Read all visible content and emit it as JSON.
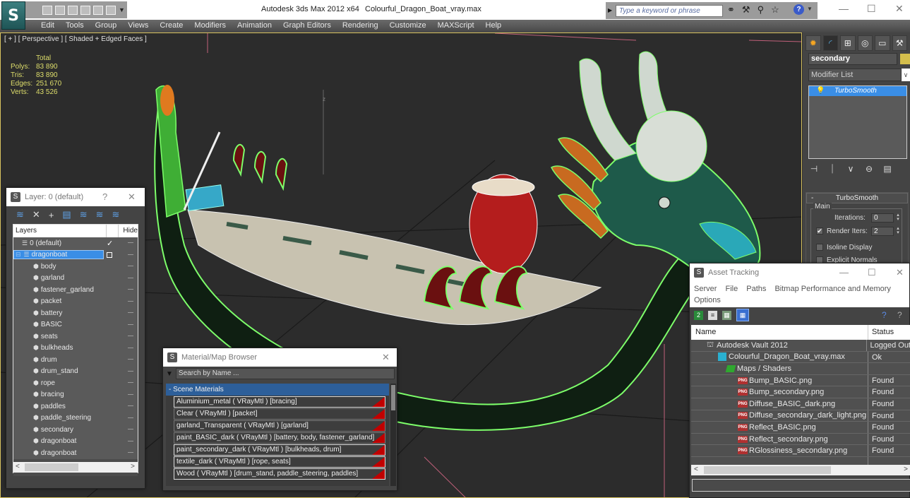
{
  "app": {
    "title": "Autodesk 3ds Max  2012 x64",
    "file": "Colourful_Dragon_Boat_vray.max",
    "logo": "3ds-max-logo",
    "search_placeholder": "Type a keyword or phrase",
    "infocenter_icons": [
      "binoculars-icon",
      "wrench-icon",
      "satellite-icon",
      "star-icon"
    ],
    "help": "?",
    "window_controls": {
      "minimize": "—",
      "maximize": "☐",
      "close": "✕"
    }
  },
  "menu": [
    "Edit",
    "Tools",
    "Group",
    "Views",
    "Create",
    "Modifiers",
    "Animation",
    "Graph Editors",
    "Rendering",
    "Customize",
    "MAXScript",
    "Help"
  ],
  "viewport": {
    "label": "[ + ] [ Perspective ] [ Shaded + Edged Faces ]",
    "stats": {
      "header": "Total",
      "rows": [
        {
          "key": "Polys:",
          "value": "83 890"
        },
        {
          "key": "Tris:",
          "value": "83 890"
        },
        {
          "key": "Edges:",
          "value": "251 670"
        },
        {
          "key": "Verts:",
          "value": "43 526"
        }
      ]
    },
    "axis_label": "z"
  },
  "command_panel": {
    "object_name": "secondary",
    "object_color": "#d4be4c",
    "modifier_list": "Modifier List",
    "stack": [
      "TurboSmooth"
    ],
    "rollout": {
      "title": "TurboSmooth",
      "group": "Main",
      "iterations_label": "Iterations:",
      "iterations": "0",
      "render_iters_label": "Render Iters:",
      "render_iters": "2",
      "render_iters_checked": true,
      "isoline_label": "Isoline Display",
      "explicit_label": "Explicit Normals"
    }
  },
  "layer_window": {
    "title": "Layer: 0 (default)",
    "help": "?",
    "close": "✕",
    "columns": {
      "name": "Layers",
      "hide": "Hide"
    },
    "layers": [
      {
        "name": "0 (default)",
        "type": "layer",
        "checked": true
      },
      {
        "name": "dragonboat",
        "type": "layer",
        "selected": true
      }
    ],
    "objects": [
      "body",
      "garland",
      "fastener_garland",
      "packet",
      "battery",
      "BASIC",
      "seats",
      "bulkheads",
      "drum",
      "drum_stand",
      "rope",
      "bracing",
      "paddles",
      "paddle_steering",
      "secondary",
      "dragonboat",
      "dragonboat"
    ]
  },
  "material_browser": {
    "title": "Material/Map Browser",
    "close": "✕",
    "search_placeholder": "Search by Name ...",
    "group": "- Scene Materials",
    "materials": [
      "Aluminium_metal  ( VRayMtl ) [bracing]",
      "Clear  ( VRayMtl ) [packet]",
      "garland_Transparent  ( VRayMtl ) [garland]",
      "paint_BASIC_dark  ( VRayMtl ) [battery, body, fastener_garland]",
      "paint_secondary_dark  ( VRayMtl ) [bulkheads, drum]",
      "textile_dark  ( VRayMtl ) [rope, seats]",
      "Wood  ( VRayMtl ) [drum_stand, paddle_steering, paddles]"
    ]
  },
  "asset_tracking": {
    "title": "Asset Tracking",
    "menu": [
      "Server",
      "File",
      "Paths",
      "Bitmap Performance and Memory",
      "Options"
    ],
    "columns": {
      "name": "Name",
      "status": "Status"
    },
    "rows": [
      {
        "name": "Autodesk Vault 2012",
        "status": "Logged Out",
        "indent": 1,
        "icon": "vault-icon"
      },
      {
        "name": "Colourful_Dragon_Boat_vray.max",
        "status": "Ok",
        "indent": 2,
        "icon": "max-file-icon"
      },
      {
        "name": "Maps / Shaders",
        "status": "",
        "indent": 3,
        "icon": "maps-folder-icon"
      },
      {
        "name": "Bump_BASIC.png",
        "status": "Found",
        "indent": 4,
        "icon": "png-icon"
      },
      {
        "name": "Bump_secondary.png",
        "status": "Found",
        "indent": 4,
        "icon": "png-icon"
      },
      {
        "name": "Diffuse_BASIC_dark.png",
        "status": "Found",
        "indent": 4,
        "icon": "png-icon"
      },
      {
        "name": "Diffuse_secondary_dark_light.png",
        "status": "Found",
        "indent": 4,
        "icon": "png-icon"
      },
      {
        "name": "Reflect_BASIC.png",
        "status": "Found",
        "indent": 4,
        "icon": "png-icon"
      },
      {
        "name": "Reflect_secondary.png",
        "status": "Found",
        "indent": 4,
        "icon": "png-icon"
      },
      {
        "name": "RGlossiness_secondary.png",
        "status": "Found",
        "indent": 4,
        "icon": "png-icon"
      }
    ]
  }
}
